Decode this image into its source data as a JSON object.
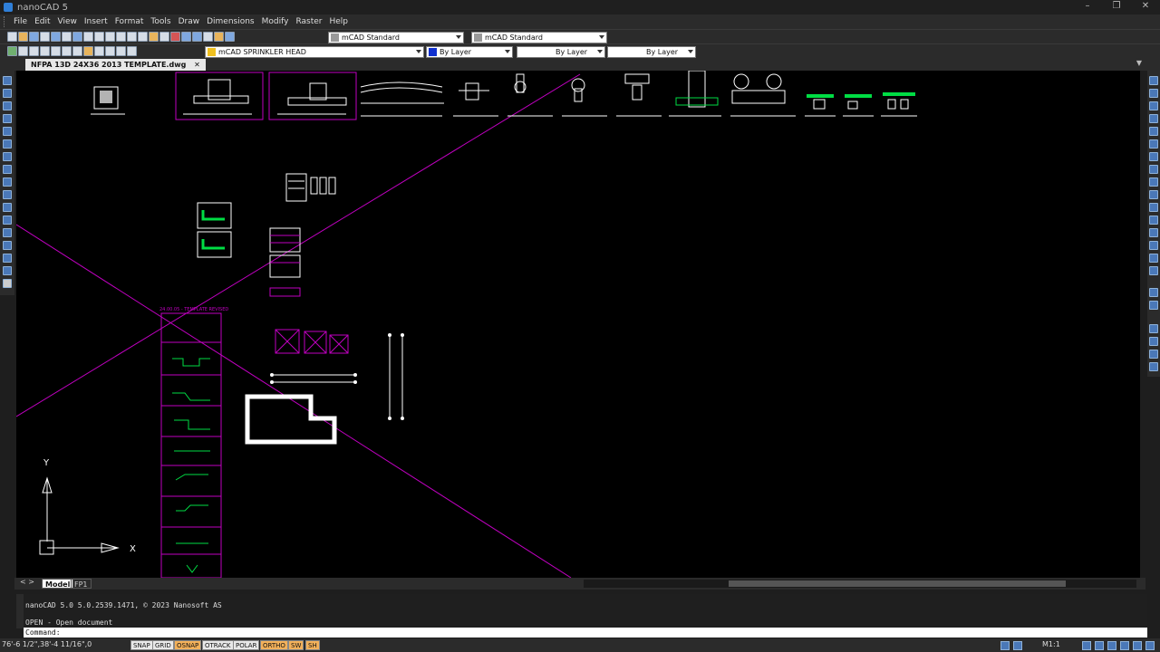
{
  "window": {
    "title": "nanoCAD 5",
    "controls": [
      "–",
      "❐",
      "✕"
    ]
  },
  "menu": [
    "File",
    "Edit",
    "View",
    "Insert",
    "Format",
    "Tools",
    "Draw",
    "Dimensions",
    "Modify",
    "Raster",
    "Help"
  ],
  "toolbar1": {
    "text_style": "mCAD Standard",
    "dim_style": "mCAD Standard"
  },
  "toolbar2": {
    "layer": "mCAD SPRINKLER HEAD",
    "color": "By Layer",
    "linetype": "By Layer",
    "lineweight": "By Layer"
  },
  "document_tab": {
    "label": "NFPA 13D 24X36 2013 TEMPLATE.dwg",
    "close": "✕",
    "menu": "▼"
  },
  "layout": {
    "nav": "< >",
    "tabs": [
      "Model",
      "FP1"
    ]
  },
  "command": {
    "lines": [
      "nanoCAD 5.0 5.0.2539.1471, © 2023 Nanosoft AS",
      "OPEN - Open document"
    ],
    "prompt": "Command:"
  },
  "status": {
    "coords": "76'-6 1/2\",38'-4 11/16\",0",
    "buttons": [
      {
        "label": "SNAP",
        "on": false
      },
      {
        "label": "GRID",
        "on": false
      },
      {
        "label": "OSNAP",
        "on": true
      },
      {
        "label": "OTRACK",
        "on": false
      },
      {
        "label": "POLAR",
        "on": false
      },
      {
        "label": "ORTHO",
        "on": true
      },
      {
        "label": "SW",
        "on": true
      },
      {
        "label": "SH",
        "on": true
      }
    ],
    "scale": "M1:1"
  },
  "drawing": {
    "ucs_x": "X",
    "ucs_y": "Y",
    "schedule_title": "24.00.05 - TEMPLATE REVISED",
    "colors": {
      "background": "#000000",
      "magenta": "#c000c0",
      "green": "#00dd44",
      "white": "#ffffff"
    }
  }
}
